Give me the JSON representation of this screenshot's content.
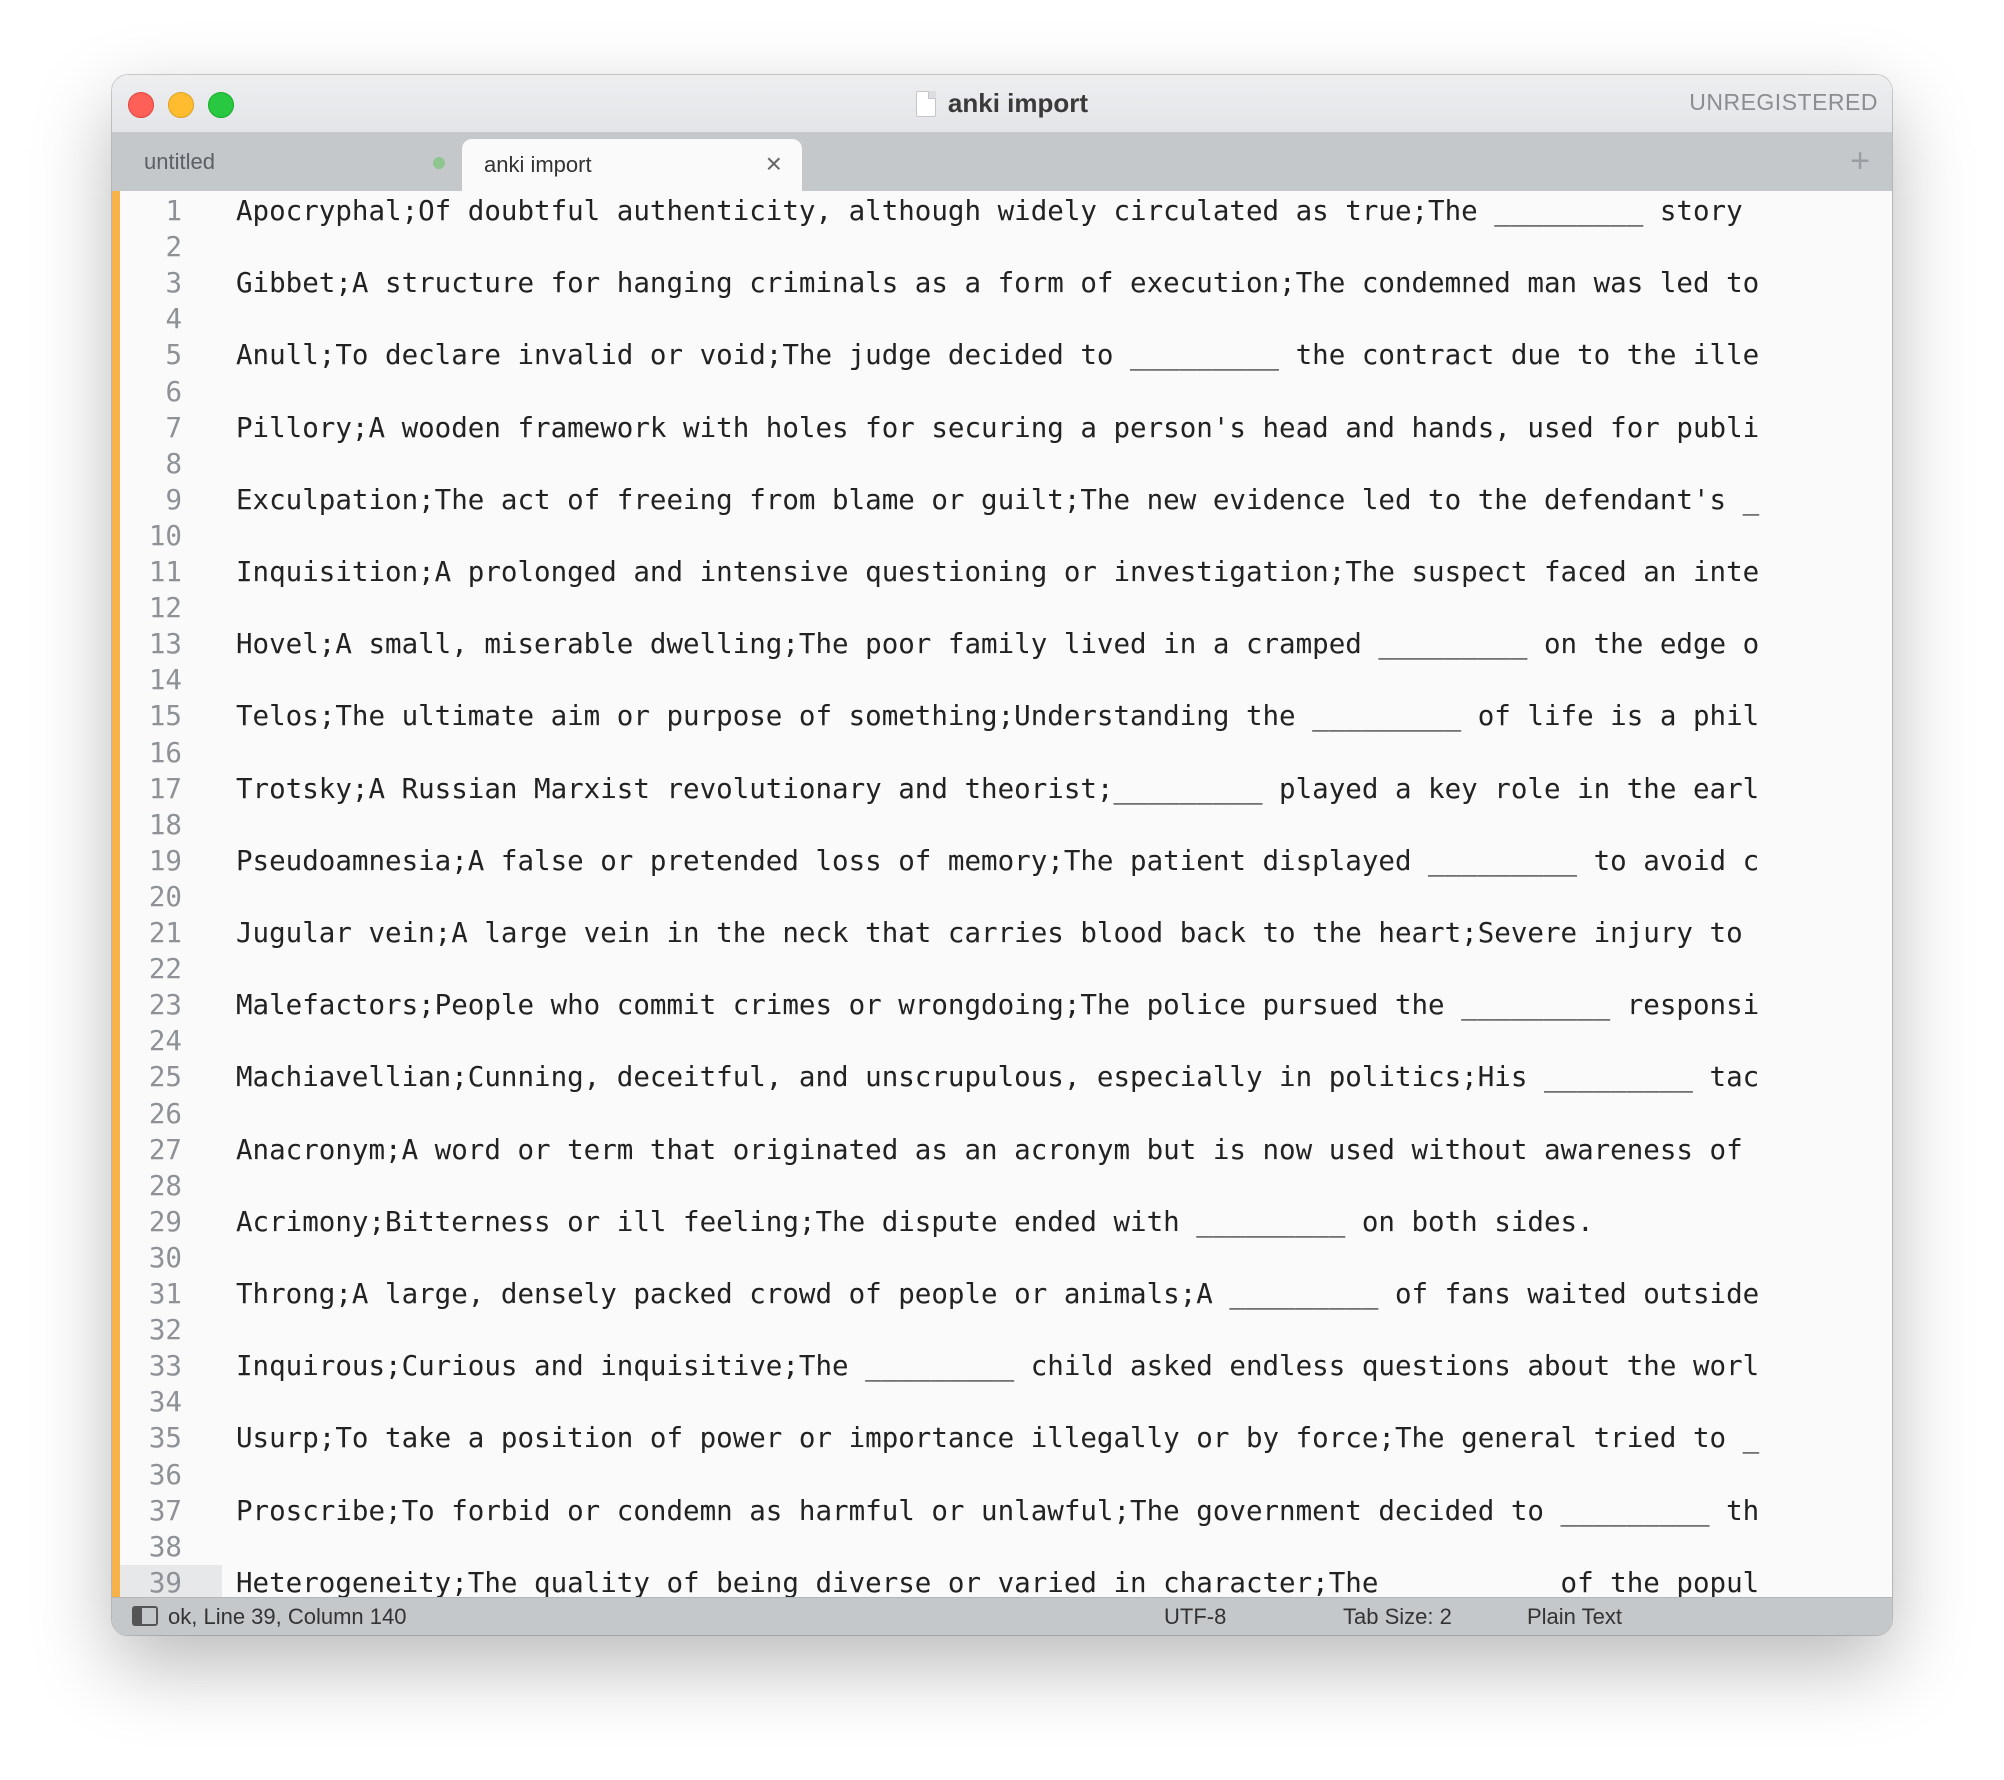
{
  "window": {
    "title": "anki import",
    "unregistered_label": "UNREGISTERED"
  },
  "tabs": [
    {
      "label": "untitled",
      "active": false,
      "dirty": true
    },
    {
      "label": "anki import",
      "active": true,
      "dirty": false
    }
  ],
  "new_tab_label": "+",
  "tab_close_glyph": "×",
  "editor": {
    "current_line": 39,
    "lines": [
      {
        "num": "1",
        "text": "Apocryphal;Of doubtful authenticity, although widely circulated as true;The _________ story"
      },
      {
        "num": "2",
        "text": ""
      },
      {
        "num": "3",
        "text": "Gibbet;A structure for hanging criminals as a form of execution;The condemned man was led to"
      },
      {
        "num": "4",
        "text": ""
      },
      {
        "num": "5",
        "text": "Anull;To declare invalid or void;The judge decided to _________ the contract due to the ille"
      },
      {
        "num": "6",
        "text": ""
      },
      {
        "num": "7",
        "text": "Pillory;A wooden framework with holes for securing a person's head and hands, used for publi"
      },
      {
        "num": "8",
        "text": ""
      },
      {
        "num": "9",
        "text": "Exculpation;The act of freeing from blame or guilt;The new evidence led to the defendant's _"
      },
      {
        "num": "10",
        "text": ""
      },
      {
        "num": "11",
        "text": "Inquisition;A prolonged and intensive questioning or investigation;The suspect faced an inte"
      },
      {
        "num": "12",
        "text": ""
      },
      {
        "num": "13",
        "text": "Hovel;A small, miserable dwelling;The poor family lived in a cramped _________ on the edge o"
      },
      {
        "num": "14",
        "text": ""
      },
      {
        "num": "15",
        "text": "Telos;The ultimate aim or purpose of something;Understanding the _________ of life is a phil"
      },
      {
        "num": "16",
        "text": ""
      },
      {
        "num": "17",
        "text": "Trotsky;A Russian Marxist revolutionary and theorist;_________ played a key role in the earl"
      },
      {
        "num": "18",
        "text": ""
      },
      {
        "num": "19",
        "text": "Pseudoamnesia;A false or pretended loss of memory;The patient displayed _________ to avoid c"
      },
      {
        "num": "20",
        "text": ""
      },
      {
        "num": "21",
        "text": "Jugular vein;A large vein in the neck that carries blood back to the heart;Severe injury to"
      },
      {
        "num": "22",
        "text": ""
      },
      {
        "num": "23",
        "text": "Malefactors;People who commit crimes or wrongdoing;The police pursued the _________ responsi"
      },
      {
        "num": "24",
        "text": ""
      },
      {
        "num": "25",
        "text": "Machiavellian;Cunning, deceitful, and unscrupulous, especially in politics;His _________ tac"
      },
      {
        "num": "26",
        "text": ""
      },
      {
        "num": "27",
        "text": "Anacronym;A word or term that originated as an acronym but is now used without awareness of"
      },
      {
        "num": "28",
        "text": ""
      },
      {
        "num": "29",
        "text": "Acrimony;Bitterness or ill feeling;The dispute ended with _________ on both sides."
      },
      {
        "num": "30",
        "text": ""
      },
      {
        "num": "31",
        "text": "Throng;A large, densely packed crowd of people or animals;A _________ of fans waited outside"
      },
      {
        "num": "32",
        "text": ""
      },
      {
        "num": "33",
        "text": "Inquirous;Curious and inquisitive;The _________ child asked endless questions about the worl"
      },
      {
        "num": "34",
        "text": ""
      },
      {
        "num": "35",
        "text": "Usurp;To take a position of power or importance illegally or by force;The general tried to _"
      },
      {
        "num": "36",
        "text": ""
      },
      {
        "num": "37",
        "text": "Proscribe;To forbid or condemn as harmful or unlawful;The government decided to _________ th"
      },
      {
        "num": "38",
        "text": ""
      },
      {
        "num": "39",
        "text": "Heterogeneity;The quality of being diverse or varied in character;The _________ of the popul"
      }
    ]
  },
  "status": {
    "position": "ok, Line 39, Column 140",
    "encoding": "UTF-8",
    "tab_size": "Tab Size: 2",
    "syntax": "Plain Text"
  },
  "colors": {
    "modified_bar": "#f8b24a",
    "close": "#fe5f57",
    "minimize": "#febc2e",
    "zoom": "#28c840"
  }
}
